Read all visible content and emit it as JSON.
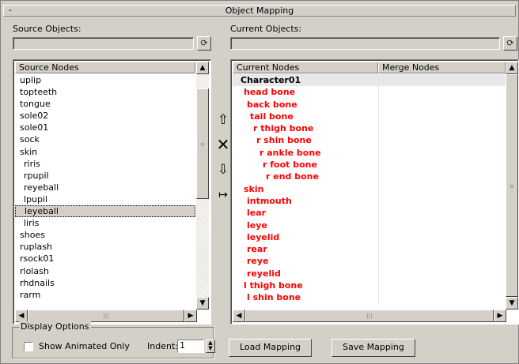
{
  "window": {
    "title": "Object Mapping",
    "collapse_glyph": "-"
  },
  "source": {
    "label": "Source Objects:",
    "value": "",
    "list_header": "Source Nodes",
    "nodes": [
      {
        "name": "uplip",
        "indent": 0
      },
      {
        "name": "topteeth",
        "indent": 0
      },
      {
        "name": "tongue",
        "indent": 0
      },
      {
        "name": "sole02",
        "indent": 0
      },
      {
        "name": "sole01",
        "indent": 0
      },
      {
        "name": "sock",
        "indent": 0
      },
      {
        "name": "skin",
        "indent": 0
      },
      {
        "name": "riris",
        "indent": 1
      },
      {
        "name": "rpupil",
        "indent": 1
      },
      {
        "name": "reyeball",
        "indent": 1
      },
      {
        "name": "lpupil",
        "indent": 1
      },
      {
        "name": "leyeball",
        "indent": 1,
        "selected": true
      },
      {
        "name": "liris",
        "indent": 1
      },
      {
        "name": "shoes",
        "indent": 0
      },
      {
        "name": "ruplash",
        "indent": 0
      },
      {
        "name": "rsock01",
        "indent": 0
      },
      {
        "name": "rlolash",
        "indent": 0
      },
      {
        "name": "rhdnails",
        "indent": 0
      },
      {
        "name": "rarm",
        "indent": 0
      }
    ]
  },
  "current": {
    "label": "Current Objects:",
    "value": "",
    "header_nodes": "Current Nodes",
    "header_merge": "Merge Nodes",
    "nodes": [
      {
        "name": "Character01",
        "indent": 0,
        "root": true
      },
      {
        "name": "head bone",
        "indent": 1
      },
      {
        "name": "back bone",
        "indent": 2
      },
      {
        "name": "tail bone",
        "indent": 3
      },
      {
        "name": "r thigh bone",
        "indent": 4
      },
      {
        "name": "r shin bone",
        "indent": 5
      },
      {
        "name": "r ankle bone",
        "indent": 6
      },
      {
        "name": "r foot bone",
        "indent": 7
      },
      {
        "name": "r end bone",
        "indent": 8
      },
      {
        "name": "skin",
        "indent": 1
      },
      {
        "name": "intmouth",
        "indent": 2
      },
      {
        "name": "lear",
        "indent": 2
      },
      {
        "name": "leye",
        "indent": 2
      },
      {
        "name": "leyelid",
        "indent": 2
      },
      {
        "name": "rear",
        "indent": 2
      },
      {
        "name": "reye",
        "indent": 2
      },
      {
        "name": "reyelid",
        "indent": 2
      },
      {
        "name": "l thigh bone",
        "indent": 1
      },
      {
        "name": "l shin bone",
        "indent": 2
      }
    ]
  },
  "display_options": {
    "legend": "Display Options",
    "show_animated_label": "Show Animated Only",
    "show_animated_checked": false,
    "indent_label": "Indent:",
    "indent_value": "1"
  },
  "buttons": {
    "load": "Load Mapping",
    "save": "Save Mapping"
  },
  "icons": {
    "refresh": "refresh-icon",
    "move_up": "arrow-up-icon",
    "remove": "x-icon",
    "move_down": "arrow-down-icon",
    "map": "map-arrow-icon"
  }
}
